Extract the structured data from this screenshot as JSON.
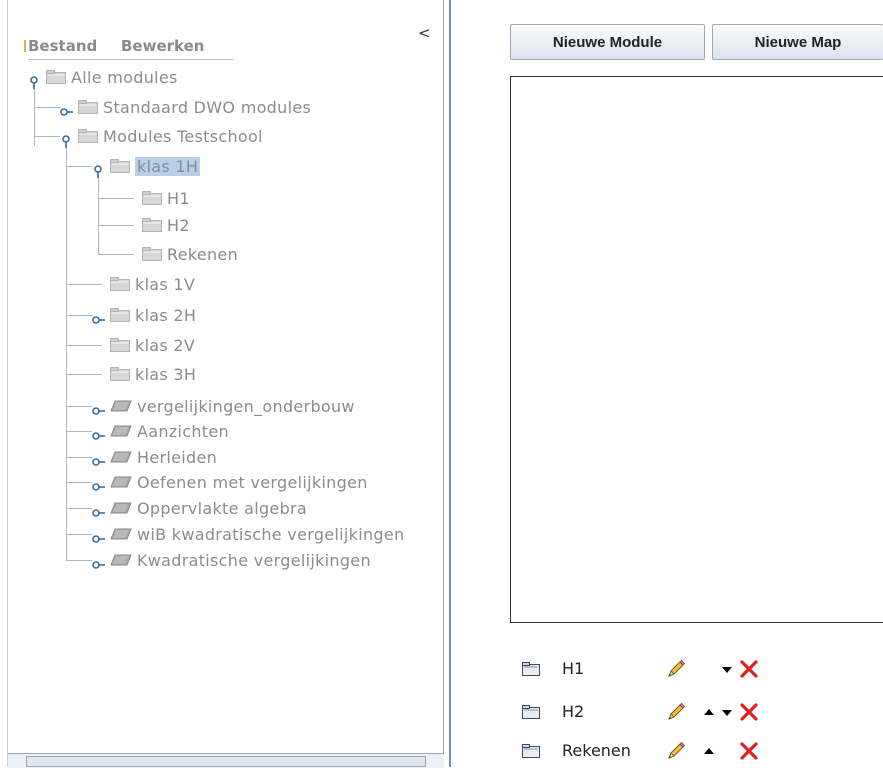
{
  "menu": {
    "items": [
      "Bestand",
      "Bewerken"
    ]
  },
  "collapse_glyph": "<",
  "tree": {
    "nodes": [
      {
        "label": "Alle modules",
        "icon": "folder-icon",
        "expanded": true
      },
      {
        "label": "Standaard DWO modules",
        "icon": "folder-icon",
        "expandable": true
      },
      {
        "label": "Modules Testschool",
        "icon": "folder-icon",
        "expanded": true
      },
      {
        "label": "klas 1H",
        "icon": "folder-icon",
        "expanded": true,
        "selected": true
      },
      {
        "label": "H1",
        "icon": "folder-icon"
      },
      {
        "label": "H2",
        "icon": "folder-icon"
      },
      {
        "label": "Rekenen",
        "icon": "folder-icon"
      },
      {
        "label": "klas 1V",
        "icon": "folder-icon"
      },
      {
        "label": "klas 2H",
        "icon": "folder-icon",
        "expandable": true
      },
      {
        "label": "klas 2V",
        "icon": "folder-icon"
      },
      {
        "label": "klas 3H",
        "icon": "folder-icon"
      },
      {
        "label": "vergelijkingen_onderbouw",
        "icon": "book-icon",
        "expandable": true
      },
      {
        "label": "Aanzichten",
        "icon": "book-icon",
        "expandable": true
      },
      {
        "label": "Herleiden",
        "icon": "book-icon",
        "expandable": true
      },
      {
        "label": "Oefenen met vergelijkingen",
        "icon": "book-icon",
        "expandable": true
      },
      {
        "label": "Oppervlakte algebra",
        "icon": "book-icon",
        "expandable": true
      },
      {
        "label": "wiB kwadratische vergelijkingen",
        "icon": "book-icon",
        "expandable": true
      },
      {
        "label": "Kwadratische vergelijkingen",
        "icon": "book-icon",
        "expandable": true
      }
    ]
  },
  "toolbar": {
    "new_module": "Nieuwe Module",
    "new_map": "Nieuwe Map"
  },
  "modules": [
    {
      "label": "H1",
      "actions": [
        "edit",
        "move-down",
        "delete"
      ]
    },
    {
      "label": "H2",
      "actions": [
        "edit",
        "move-up",
        "move-down",
        "delete"
      ]
    },
    {
      "label": "Rekenen",
      "actions": [
        "edit",
        "move-up",
        "delete"
      ]
    }
  ],
  "colors": {
    "accent": "#6f8fb3",
    "selection": "#b8cfe5",
    "delete": "#e02020"
  }
}
